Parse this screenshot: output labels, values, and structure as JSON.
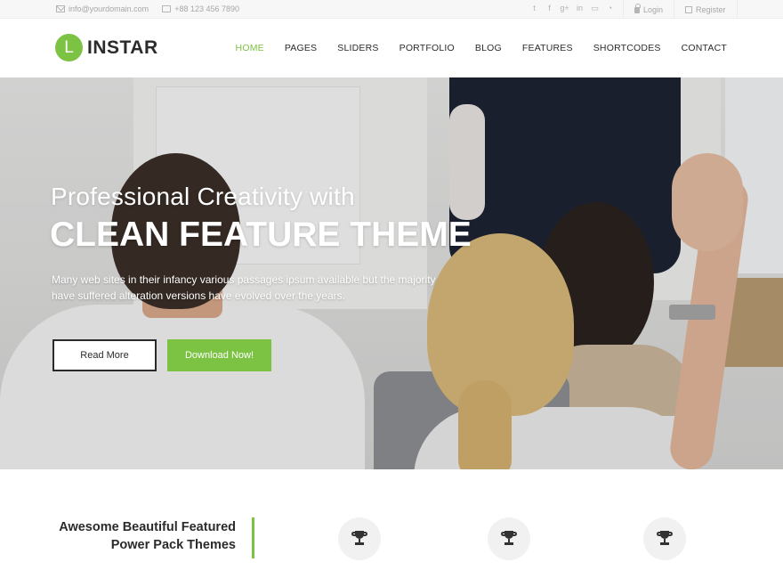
{
  "topbar": {
    "email": "info@yourdomain.com",
    "phone": "+88 123 456 7890",
    "social": [
      "twitter",
      "facebook",
      "google-plus",
      "linkedin",
      "youtube",
      "rss"
    ],
    "login": "Login",
    "register": "Register"
  },
  "brand": {
    "mark": "L",
    "name": "INSTAR",
    "accent_color": "#7cc243"
  },
  "nav": {
    "items": [
      "HOME",
      "PAGES",
      "SLIDERS",
      "PORTFOLIO",
      "BLOG",
      "FEATURES",
      "SHORTCODES",
      "CONTACT"
    ],
    "active": "HOME"
  },
  "hero": {
    "subtitle": "Professional Creativity with",
    "title": "CLEAN FEATURE THEME",
    "description": "Many web sites in their infancy various passages ipsum available but the majority have suffered alteration  versions have evolved over the years.",
    "primary_button": "Read More",
    "secondary_button": "Download Now!"
  },
  "features": {
    "intro_line1": "Awesome Beautiful Featured",
    "intro_line2": "Power Pack Themes",
    "icons": [
      "trophy-icon",
      "trophy-icon",
      "trophy-icon"
    ]
  }
}
